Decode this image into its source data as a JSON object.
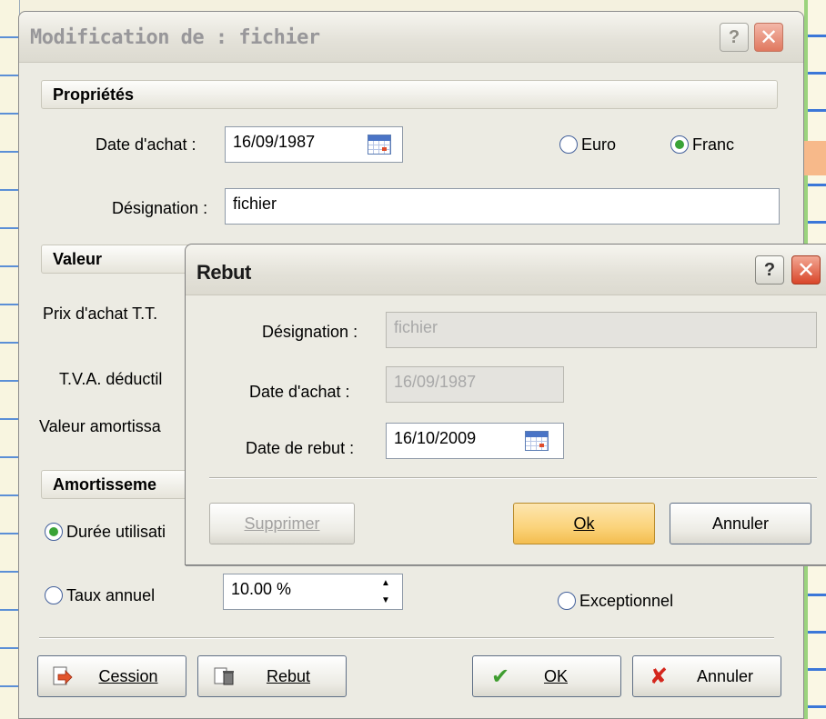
{
  "main_dialog": {
    "title": "Modification de : fichier",
    "help_label": "?",
    "close_label": "✕",
    "sections": {
      "properties": "Propriétés",
      "value": "Valeur",
      "depreciation": "Amortisseme"
    },
    "date_achat_label": "Date d'achat :",
    "date_achat_value": "16/09/1987",
    "currency_options": [
      "Euro",
      "Franc"
    ],
    "currency_selected": "Franc",
    "designation_label": "Désignation :",
    "designation_value": "fichier",
    "value_labels": {
      "prix_achat": "Prix d'achat T.T.",
      "tva": "T.V.A. déductil",
      "valeur_amortissable": "Valeur amortissa"
    },
    "depreciation": {
      "duree_label": "Durée utilisati",
      "taux_label": "Taux annuel",
      "taux_value": "10.00 %",
      "exceptionnel_label": "Exceptionnel"
    },
    "buttons": {
      "cession": "Cession",
      "rebut": "Rebut",
      "ok": "OK",
      "annuler": "Annuler"
    }
  },
  "rebut_dialog": {
    "title": "Rebut",
    "help_label": "?",
    "close_label": "✕",
    "designation_label": "Désignation :",
    "designation_value": "fichier",
    "date_achat_label": "Date d'achat :",
    "date_achat_value": "16/09/1987",
    "date_rebut_label": "Date de rebut :",
    "date_rebut_value": "16/10/2009",
    "buttons": {
      "supprimer": "Supprimer",
      "ok": "Ok",
      "annuler": "Annuler"
    }
  },
  "colors": {
    "accent_ok_button": "#fbd37a",
    "radio_selected": "#3aa337",
    "close_button": "#e0785f"
  }
}
